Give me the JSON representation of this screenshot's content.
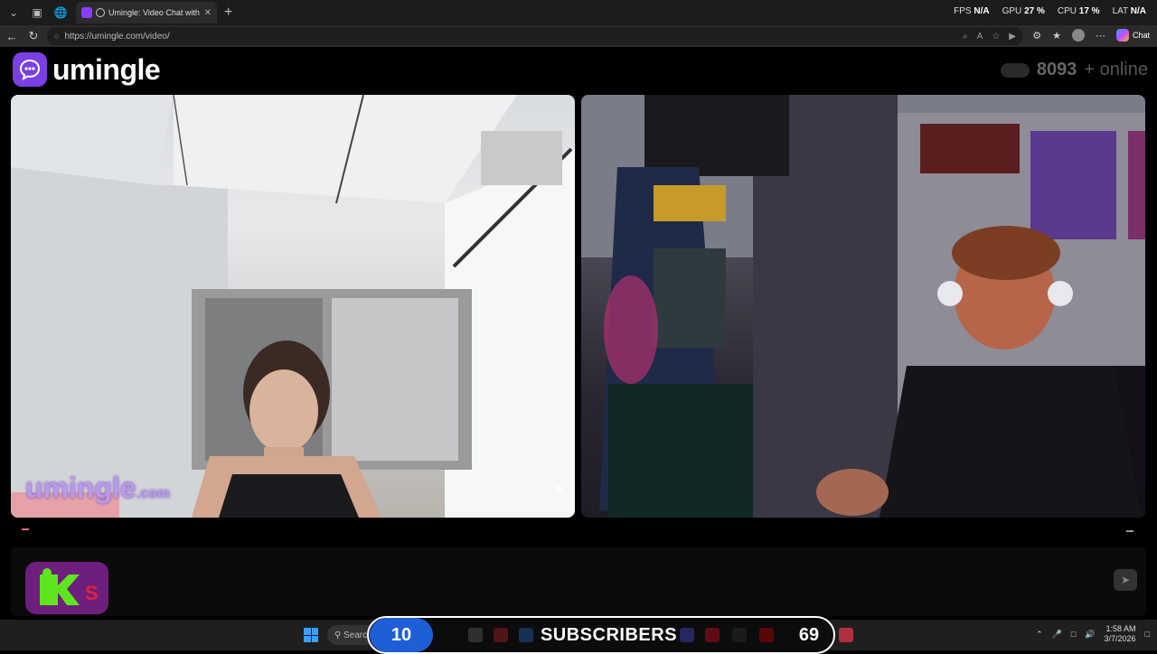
{
  "browser": {
    "tab_title": "Umingle: Video Chat with Stra",
    "url": "https://umingle.com/video/",
    "copilot_label": "Chat"
  },
  "perf": {
    "fps_label": "FPS",
    "fps_value": "N/A",
    "gpu_label": "GPU",
    "gpu_value": "27 %",
    "cpu_label": "CPU",
    "cpu_value": "17 %",
    "lat_label": "LAT",
    "lat_value": "N/A"
  },
  "site": {
    "logo_text": "umingle",
    "online_count": "8093",
    "online_suffix": "+ online",
    "watermark_main": "umingle",
    "watermark_tld": ".com"
  },
  "overlay": {
    "sub_left_count": "10",
    "sub_label": "SUBSCRIBERS",
    "sub_right_count": "69"
  },
  "taskbar": {
    "search_placeholder": "Search",
    "time": "1:58 AM",
    "date": "3/7/2026"
  },
  "colors": {
    "brand": "#7b3fe4",
    "stop_button": "#6e1e7c",
    "overlay_accent": "#1e5fd8"
  }
}
